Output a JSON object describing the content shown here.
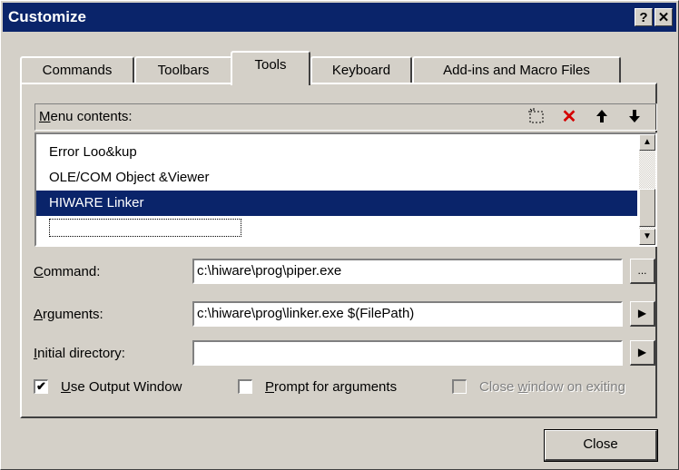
{
  "window": {
    "title": "Customize",
    "help_button": "?",
    "close_button": "✕"
  },
  "tabs": [
    {
      "label": "Commands",
      "active": false
    },
    {
      "label": "Toolbars",
      "active": false
    },
    {
      "label": "Tools",
      "active": true
    },
    {
      "label": "Keyboard",
      "active": false
    },
    {
      "label": "Add-ins and Macro Files",
      "active": false
    }
  ],
  "menu_contents": {
    "label": "Menu contents:",
    "icons": {
      "new": "new-item-icon",
      "delete": "delete-icon",
      "up": "move-up-icon",
      "down": "move-down-icon"
    },
    "items": [
      {
        "text": "Error Loo&kup",
        "selected": false
      },
      {
        "text": "OLE/COM Object &Viewer",
        "selected": false
      },
      {
        "text": "HIWARE Linker",
        "selected": true
      },
      {
        "text": "",
        "selected": false
      }
    ]
  },
  "fields": {
    "command": {
      "label": "Command:",
      "value": "c:\\hiware\\prog\\piper.exe",
      "button": "..."
    },
    "arguments": {
      "label": "Arguments:",
      "value": "c:\\hiware\\prog\\linker.exe $(FilePath)",
      "button": "▶"
    },
    "initial_directory": {
      "label": "Initial directory:",
      "value": "",
      "button": "▶"
    }
  },
  "options": {
    "use_output_window": {
      "label": "Use Output Window",
      "checked": true,
      "enabled": true
    },
    "prompt_for_arguments": {
      "label": "Prompt for arguments",
      "checked": false,
      "enabled": true
    },
    "close_window_on_exiting": {
      "label": "Close window on exiting",
      "checked": false,
      "enabled": false
    }
  },
  "buttons": {
    "close": "Close"
  },
  "colors": {
    "face": "#d4d0c8",
    "titlebar": "#0a246a",
    "selection": "#0a246a",
    "delete_icon": "#d40000"
  }
}
